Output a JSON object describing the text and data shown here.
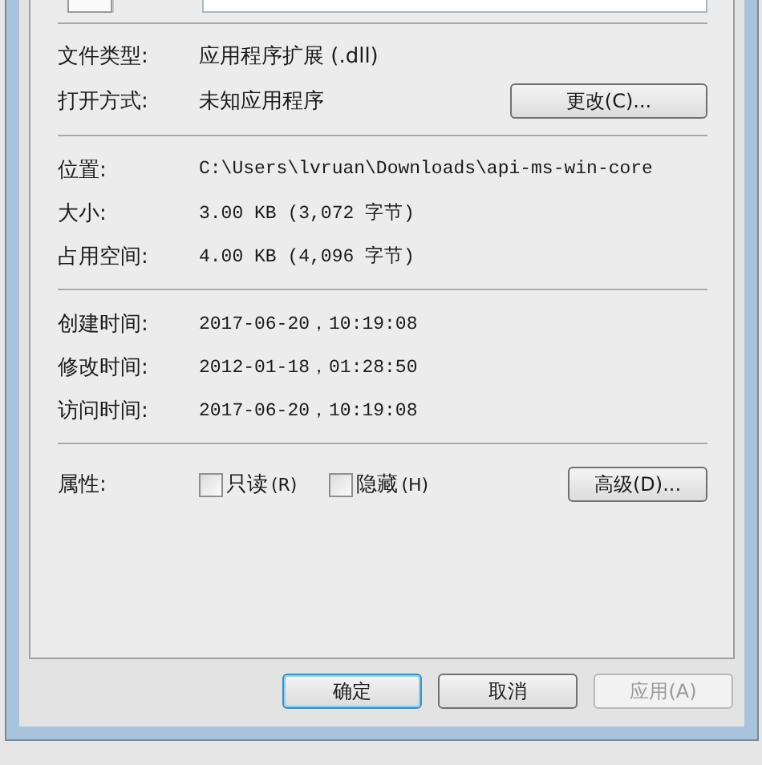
{
  "sections": [
    {
      "rows": [
        {
          "label": "文件类型:",
          "value": "应用程序扩展 (.dll)"
        },
        {
          "label": "打开方式:",
          "value": "未知应用程序",
          "button": "更改(C)..."
        }
      ]
    },
    {
      "rows": [
        {
          "label": "位置:",
          "value": "C:\\Users\\lvruan\\Downloads\\api-ms-win-core",
          "mono": true
        },
        {
          "label": "大小:",
          "value": "3.00 KB (3,072 字节)",
          "mono": true
        },
        {
          "label": "占用空间:",
          "value": "4.00 KB (4,096 字节)",
          "mono": true
        }
      ]
    },
    {
      "rows": [
        {
          "label": "创建时间:",
          "value": "2017-06-20，10:19:08",
          "mono": true
        },
        {
          "label": "修改时间:",
          "value": "2012-01-18，01:28:50",
          "mono": true
        },
        {
          "label": "访问时间:",
          "value": "2017-06-20，10:19:08",
          "mono": true
        }
      ]
    }
  ],
  "attributes": {
    "label": "属性:",
    "checkboxes": [
      {
        "label": "只读",
        "key": "(R)",
        "checked": false
      },
      {
        "label": "隐藏",
        "key": "(H)",
        "checked": false
      }
    ],
    "button": "高级(D)..."
  },
  "buttons": [
    {
      "label": "确定",
      "default": true,
      "disabled": false
    },
    {
      "label": "取消",
      "default": false,
      "disabled": false
    },
    {
      "label": "应用(A)",
      "default": false,
      "disabled": true
    }
  ]
}
